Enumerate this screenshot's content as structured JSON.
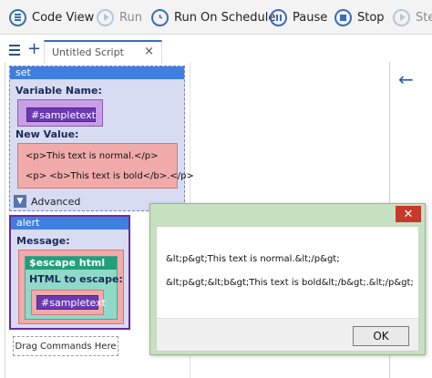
{
  "toolbar": {
    "code_view": "Code View",
    "run": "Run",
    "run_on_schedule": "Run On Schedule",
    "pause": "Pause",
    "stop": "Stop",
    "step": "Ste"
  },
  "tabs": {
    "active_title": "Untitled Script",
    "close_glyph": "×"
  },
  "set_block": {
    "header": "set",
    "variable_name_label": "Variable Name:",
    "variable_name_value": "#sampletext",
    "new_value_label": "New Value:",
    "new_value_line1": "<p>This text is normal.</p>",
    "new_value_line2": "<p> <b>This text is bold</b>.</p>",
    "advanced_label": "Advanced"
  },
  "alert_block": {
    "header": "alert",
    "message_label": "Message:",
    "escape_title": "$escape html",
    "html_to_escape_label": "HTML to escape:",
    "html_to_escape_value": "#sampletext"
  },
  "drag_placeholder": "Drag Commands Here",
  "dialog": {
    "close_glyph": "✕",
    "line1": "&lt;p&gt;This text is normal.&lt;/p&gt;",
    "line2": "&lt;p&gt;&lt;b&gt;This text is bold&lt;/b&gt;.&lt;/p&gt;",
    "ok_label": "OK"
  },
  "icons": {
    "code_view": "list-icon",
    "run": "play-icon",
    "run_on_schedule": "clock-icon",
    "pause": "pause-icon",
    "stop": "stop-icon",
    "step": "step-icon",
    "menu": "hamburger-icon",
    "add": "plus-icon",
    "back": "arrow-left-icon"
  },
  "colors": {
    "accent": "#3a6db8",
    "block_header": "#3f7fe0",
    "variable_chip": "#6a3ab0",
    "value_box": "#f1aaaa",
    "escape_header": "#1fa07a",
    "dialog_frame": "#c7e0bf",
    "dialog_close": "#c6392b"
  }
}
